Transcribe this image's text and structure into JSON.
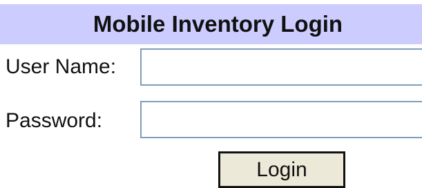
{
  "header": {
    "title": "Mobile Inventory Login"
  },
  "form": {
    "username": {
      "label": "User Name:",
      "value": "",
      "placeholder": ""
    },
    "password": {
      "label": "Password:",
      "value": "",
      "placeholder": ""
    },
    "submit_label": "Login"
  },
  "colors": {
    "header_background": "#ccccff",
    "input_border": "#7f9db9",
    "button_background": "#ece9d8"
  }
}
